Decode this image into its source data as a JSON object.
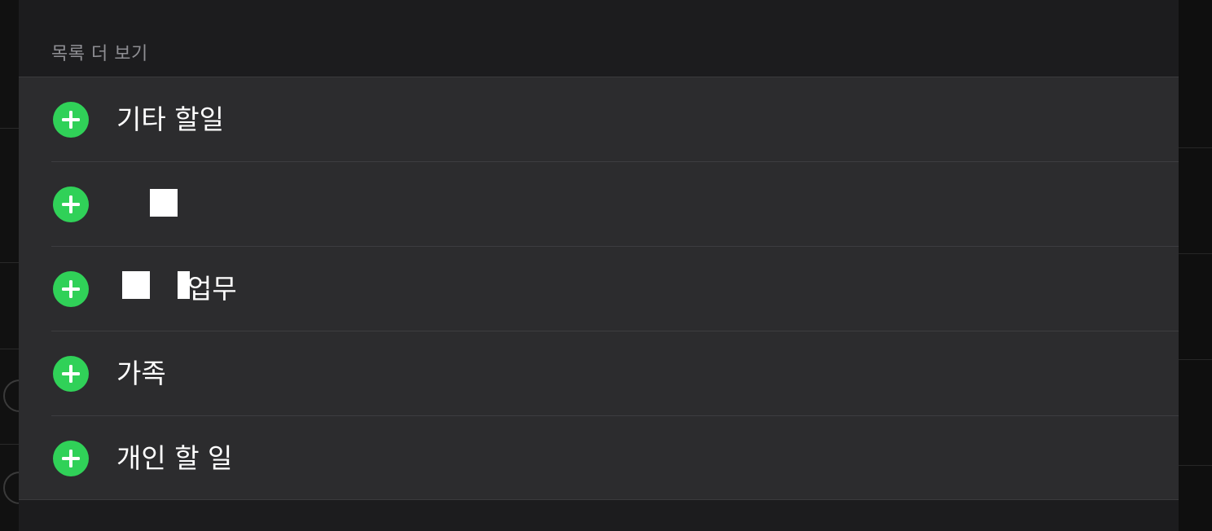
{
  "section": {
    "header": "목록 더 보기"
  },
  "lists": [
    {
      "label": "기타 할일",
      "add_icon": "plus-circle-icon",
      "redacted": false
    },
    {
      "label": "",
      "add_icon": "plus-circle-icon",
      "redacted": true
    },
    {
      "label": "업무",
      "add_icon": "plus-circle-icon",
      "redacted": true
    },
    {
      "label": "가족",
      "add_icon": "plus-circle-icon",
      "redacted": false
    },
    {
      "label": "개인 할 일",
      "add_icon": "plus-circle-icon",
      "redacted": false
    }
  ],
  "colors": {
    "accent_green": "#30d158",
    "sheet_bg": "#1c1c1e",
    "row_bg": "#2c2c2e",
    "header_text": "#8e8e93"
  }
}
